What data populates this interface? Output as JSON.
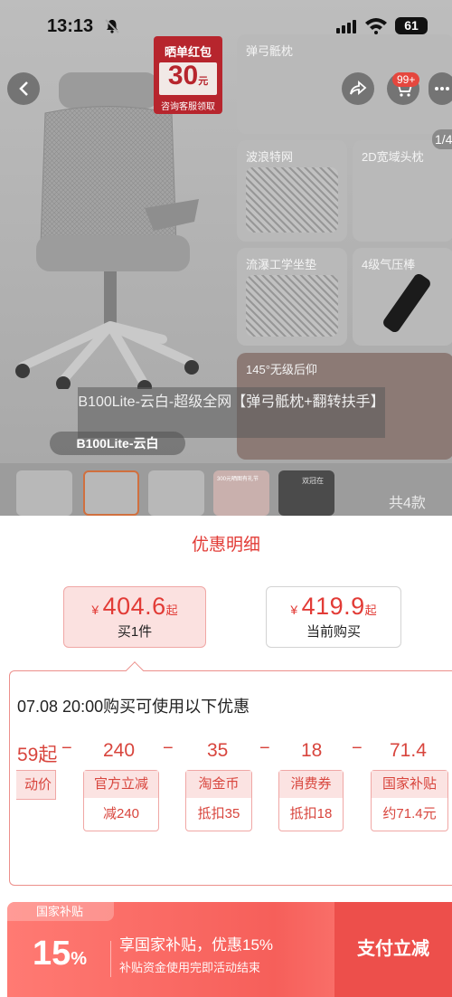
{
  "status_bar": {
    "time": "13:13",
    "battery": "61"
  },
  "product": {
    "promo": {
      "title": "晒单红包",
      "amount": "30",
      "unit": "元",
      "subtitle": "咨询客服领取"
    },
    "features": [
      "弹弓骶枕",
      "波浪特网",
      "2D宽域头枕",
      "流瀑工学坐垫",
      "4级气压棒",
      "145°无级后仰"
    ],
    "cart_badge": "99+",
    "page_indicator": "1/4",
    "caption": "B100Lite-云白-超级全网【弹弓骶枕+翻转扶手】",
    "variant_chip": "B100Lite-云白",
    "thumbnails_count": "共4款",
    "thumb_labels": [
      "300元晒图有礼节",
      "双冠在"
    ]
  },
  "sheet": {
    "title": "优惠明细",
    "price_options": [
      {
        "currency": "¥",
        "price": "404.6",
        "qualifier": "起",
        "label": "买1件"
      },
      {
        "currency": "¥",
        "price": "419.9",
        "qualifier": "起",
        "label": "当前购买"
      }
    ],
    "detail_title": "07.08 20:00购买可使用以下优惠",
    "calc": {
      "partial": "59起",
      "values": [
        "240",
        "35",
        "18",
        "71.4"
      ],
      "minus": "−"
    },
    "partial_coupon": "动价",
    "coupons": [
      {
        "name": "官方立减",
        "desc": "减240"
      },
      {
        "name": "淘金币",
        "desc": "抵扣35"
      },
      {
        "name": "消费券",
        "desc": "抵扣18"
      },
      {
        "name": "国家补贴",
        "desc": "约71.4元"
      }
    ],
    "subsidy": {
      "tag": "国家补贴",
      "percent": "15",
      "percent_sign": "%",
      "main_text": "享国家补贴，优惠15%",
      "sub_text": "补贴资金使用完即活动结束",
      "button": "支付立减"
    }
  },
  "colors": {
    "accent": "#e23b36",
    "subsidy_bg": "#f65f5a"
  }
}
